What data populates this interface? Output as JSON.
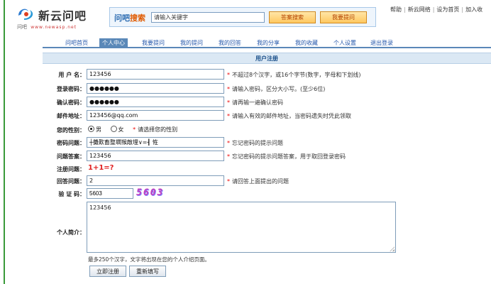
{
  "header": {
    "logo_name": "新云问吧",
    "logo_sub": "问吧",
    "logo_domain": "www.newasp.net",
    "search_title_a": "问吧",
    "search_title_b": "搜索",
    "search_placeholder": "请输入关键字",
    "search_button": "答案搜索",
    "ask_button": "我要提问",
    "toplinks": [
      "帮助",
      "新云网络",
      "设为首页",
      "加入收"
    ]
  },
  "nav": {
    "items": [
      "问吧首页",
      "个人中心",
      "我要提问",
      "我的提问",
      "我的回答",
      "我的分享",
      "我的收藏",
      "个人设置",
      "退出登录"
    ],
    "active_index": 1
  },
  "form": {
    "title": "用户注册",
    "username": {
      "label": "用 户 名：",
      "value": "123456",
      "hint": "不超过8个汉字，或16个字节(数字，字母和下划线)"
    },
    "password": {
      "label": "登录密码：",
      "value": "●●●●●●",
      "hint": "请输入密码，区分大小写。(至少6位)"
    },
    "confirm": {
      "label": "确认密码：",
      "value": "●●●●●●",
      "hint": "请再输一遍确认密码"
    },
    "email": {
      "label": "邮件地址：",
      "value": "123456@qq.com",
      "hint": "请输入有效的邮件地址，当密码遗失时凭此领取"
    },
    "gender": {
      "label": "您的性别：",
      "male": "男",
      "female": "女",
      "hint": "请选择您的性别"
    },
    "pw_question": {
      "label": "密码问题：",
      "value": "┼攤歎畜整壛猴敵埋∨=┨ 恠",
      "hint": "忘记密码的提示问题"
    },
    "pw_answer": {
      "label": "问题答案：",
      "value": "123456",
      "hint": "忘记密码的提示问题答案，用于取回登录密码"
    },
    "reg_question": {
      "label": "注册问题：",
      "value": "1+1=?"
    },
    "reg_answer": {
      "label": "回答问题：",
      "value": "2",
      "hint": "请回答上面提出的问题"
    },
    "captcha": {
      "label": "验 证 码：",
      "value": "5603",
      "image_text": "5603"
    },
    "bio": {
      "label": "个人简介：",
      "value": "123456",
      "note": "最多250个汉字，文字将出现在您的个人介绍页面。"
    },
    "submit": "立即注册",
    "reset": "重新填写"
  }
}
